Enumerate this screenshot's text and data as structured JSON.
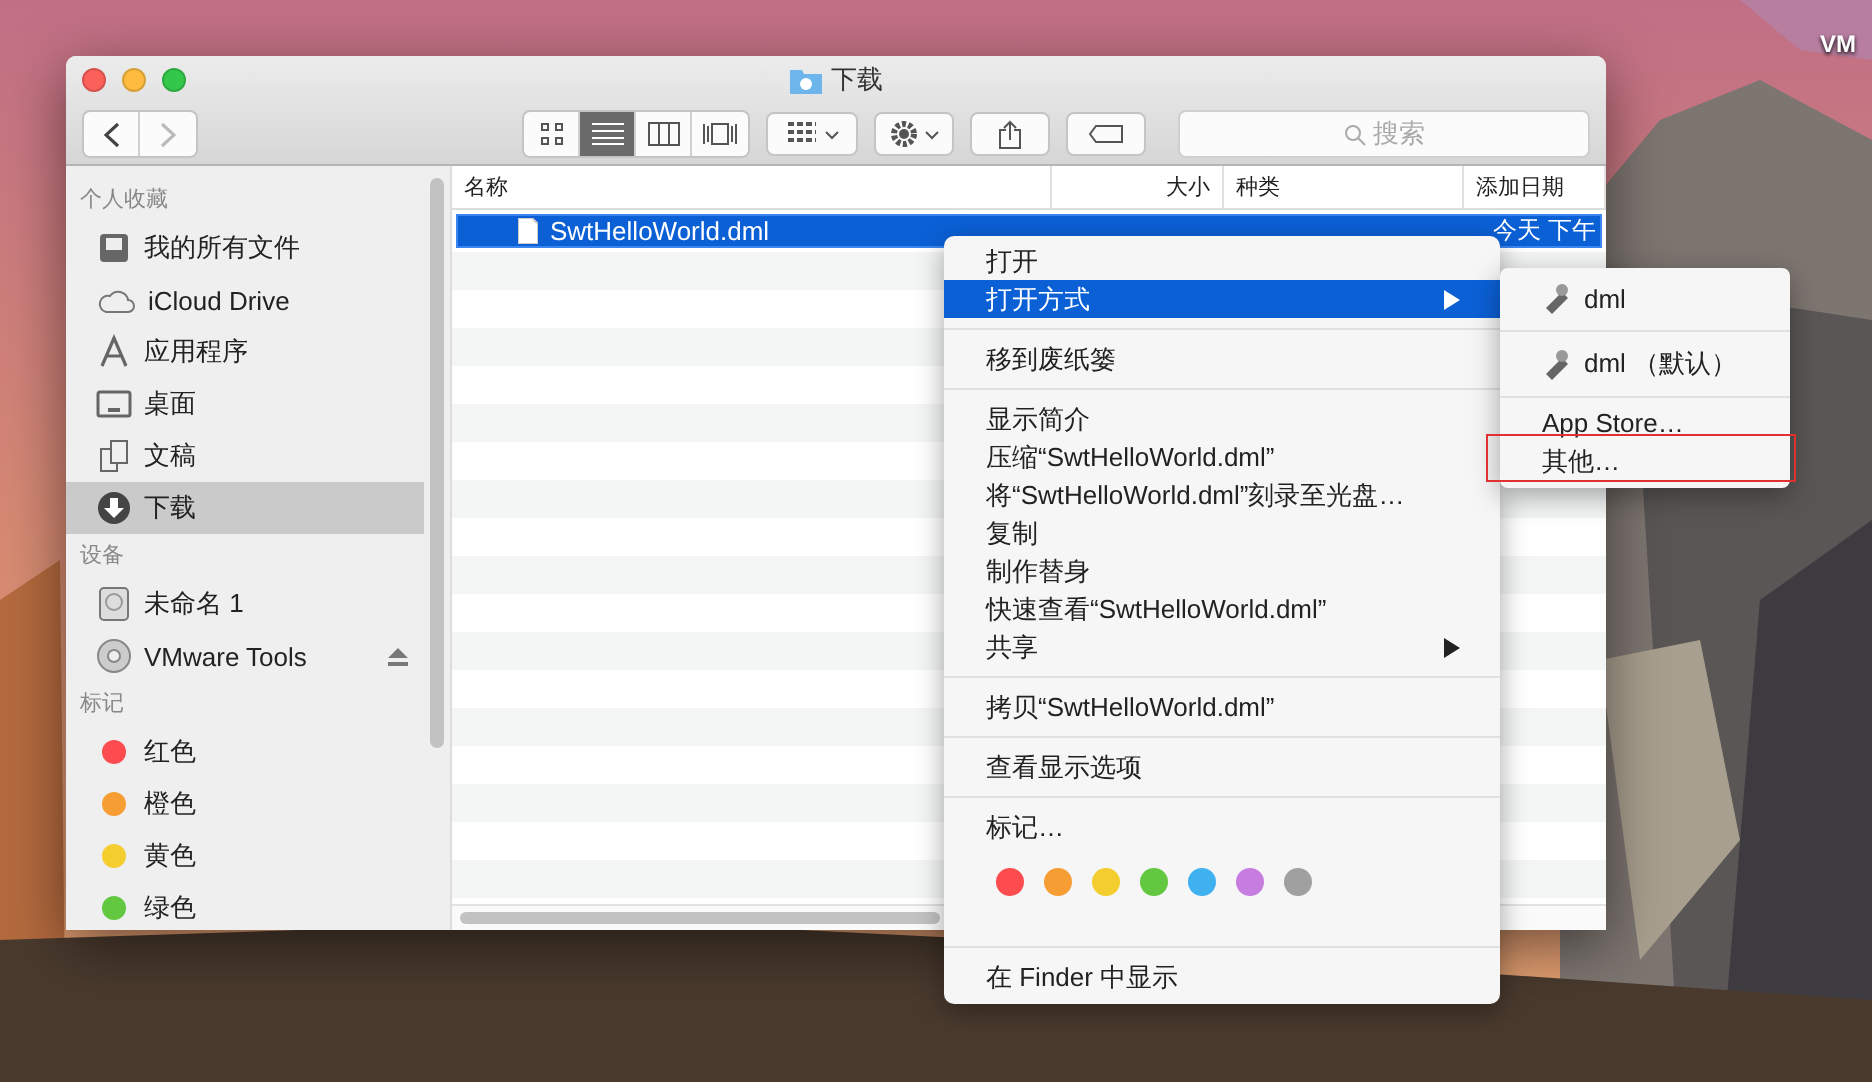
{
  "desktop": {
    "label": "VM"
  },
  "window": {
    "title": "下载"
  },
  "toolbar": {
    "views": [
      {
        "kind": "icons",
        "selected": false
      },
      {
        "kind": "list",
        "selected": true
      },
      {
        "kind": "columns",
        "selected": false
      },
      {
        "kind": "coverflow",
        "selected": false
      }
    ],
    "search": {
      "placeholder": "搜索"
    }
  },
  "sidebar": {
    "sections": [
      {
        "title": "个人收藏",
        "items": [
          {
            "label": "我的所有文件",
            "selected": false
          },
          {
            "label": "iCloud Drive",
            "selected": false
          },
          {
            "label": "应用程序",
            "selected": false
          },
          {
            "label": "桌面",
            "selected": false
          },
          {
            "label": "文稿",
            "selected": false
          },
          {
            "label": "下载",
            "selected": true
          }
        ]
      },
      {
        "title": "设备",
        "items": [
          {
            "label": "未命名 1",
            "selected": false
          },
          {
            "label": "VMware Tools",
            "selected": false,
            "eject": true
          }
        ]
      },
      {
        "title": "标记",
        "items": [
          {
            "label": "红色",
            "color": "#fc4c4f",
            "selected": false
          },
          {
            "label": "橙色",
            "color": "#f69d33",
            "selected": false
          },
          {
            "label": "黄色",
            "color": "#f4ce2f",
            "selected": false
          },
          {
            "label": "绿色",
            "color": "#61c840",
            "selected": false
          }
        ]
      }
    ]
  },
  "table": {
    "columns": [
      "名称",
      "大小",
      "种类",
      "添加日期"
    ],
    "rows": [
      {
        "name": "SwtHelloWorld.dml",
        "date": "今天 下午",
        "selected": true
      }
    ]
  },
  "context_menu": [
    {
      "kind": "item",
      "label": "打开",
      "selected": false
    },
    {
      "kind": "item",
      "label": "打开方式",
      "selected": true,
      "submenu": true
    },
    {
      "kind": "separator"
    },
    {
      "kind": "item",
      "label": "移到废纸篓",
      "selected": false
    },
    {
      "kind": "separator"
    },
    {
      "kind": "item",
      "label": "显示简介",
      "selected": false
    },
    {
      "kind": "item",
      "label": "压缩“SwtHelloWorld.dml”",
      "selected": false
    },
    {
      "kind": "item",
      "label": "将“SwtHelloWorld.dml”刻录至光盘…",
      "selected": false
    },
    {
      "kind": "item",
      "label": "复制",
      "selected": false
    },
    {
      "kind": "item",
      "label": "制作替身",
      "selected": false
    },
    {
      "kind": "item",
      "label": "快速查看“SwtHelloWorld.dml”",
      "selected": false
    },
    {
      "kind": "item",
      "label": "共享",
      "selected": false,
      "submenu": true
    },
    {
      "kind": "separator"
    },
    {
      "kind": "item",
      "label": "拷贝“SwtHelloWorld.dml”",
      "selected": false
    },
    {
      "kind": "separator"
    },
    {
      "kind": "item",
      "label": "查看显示选项",
      "selected": false
    },
    {
      "kind": "separator"
    },
    {
      "kind": "item",
      "label": "标记…",
      "selected": false
    },
    {
      "kind": "tags",
      "tags": [
        {
          "color": "#fc4c4f"
        },
        {
          "color": "#f69d33"
        },
        {
          "color": "#f4ce2f"
        },
        {
          "color": "#61c840"
        },
        {
          "color": "#3fb0f0"
        },
        {
          "color": "#c77ce0"
        },
        {
          "color": "#a0a0a0"
        }
      ]
    },
    {
      "kind": "separator"
    },
    {
      "kind": "item",
      "label": "在 Finder 中显示",
      "selected": false
    }
  ],
  "open_with_menu": [
    {
      "kind": "app",
      "label": "dml"
    },
    {
      "kind": "separator"
    },
    {
      "kind": "app",
      "label": "dml （默认）"
    },
    {
      "kind": "separator"
    },
    {
      "kind": "item",
      "label": "App Store…"
    },
    {
      "kind": "item",
      "label": "其他…",
      "highlighted": true
    }
  ]
}
